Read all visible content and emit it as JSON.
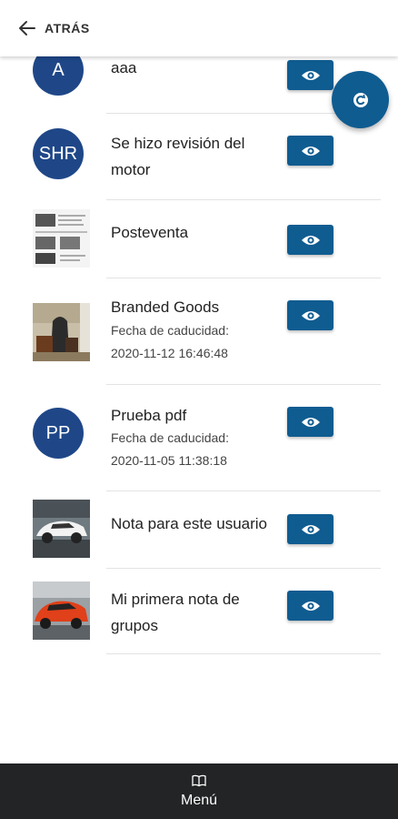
{
  "header": {
    "back_label": "ATRÁS"
  },
  "notes": [
    {
      "title": "aaa",
      "avatar": "A"
    },
    {
      "title": "Se hizo revisión del",
      "title2": "motor",
      "avatar": "SHR"
    },
    {
      "title": "Posteventa",
      "image": "document-thumbnail"
    },
    {
      "title": "Branded Goods",
      "expiry_label": "Fecha de caducidad:",
      "expiry": "2020-11-12 16:46:48",
      "image": "bags-photo"
    },
    {
      "title": "Prueba pdf",
      "avatar": "PP",
      "expiry_label": "Fecha de caducidad:",
      "expiry": "2020-11-05 11:38:18"
    },
    {
      "title": "Nota para este usuario",
      "image": "white-car-photo"
    },
    {
      "title": "Mi primera nota de",
      "title2": "grupos",
      "image": "red-car-photo"
    }
  ],
  "view_icon": "eye-icon",
  "fab_icon": "refresh-icon",
  "bottom_nav": {
    "label": "Menú",
    "icon": "book-icon"
  },
  "colors": {
    "primary": "#0f5c91",
    "avatar": "#1f4788",
    "bottom_bar": "#222426"
  }
}
